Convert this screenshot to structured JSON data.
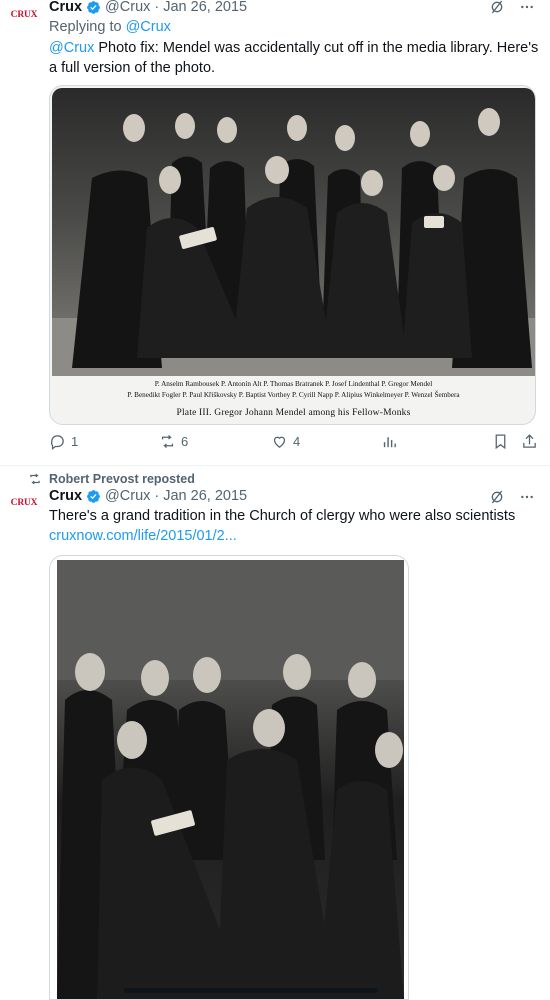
{
  "tweet1": {
    "avatar_text": "CRUX",
    "name": "Crux",
    "handle": "@Crux",
    "separator": "·",
    "date": "Jan 26, 2015",
    "replying_prefix": "Replying to",
    "replying_handle": "@Crux",
    "mention": "@Crux",
    "body": " Photo fix: Mendel was accidentally cut off in the media library. Here's a full version of the photo.",
    "caption_line1": "P. Anselm Rambousek P. Antonín Alt  P. Thomas Bratranek P. Josef Lindenthal  P. Gregor Mendel",
    "caption_line2": "P. Benedikt Fogler P. Paul Křiškovsky     P. Baptist Vorthey  P. Cyrill Napp  P. Alipius Winkelmeyer P. Wenzel Šembera",
    "caption_plate": "Plate III.  Gregor  Johann  Mendel  among  his  Fellow-Monks",
    "replies": "1",
    "reposts": "6",
    "likes": "4"
  },
  "repost_label": "Robert Prevost reposted",
  "tweet2": {
    "avatar_text": "CRUX",
    "name": "Crux",
    "handle": "@Crux",
    "separator": "·",
    "date": "Jan 26, 2015",
    "body": "There's a grand tradition in the Church of clergy who were also scientists",
    "link": "cruxnow.com/life/2015/01/2..."
  },
  "colors": {
    "accent": "#1d9bf0",
    "brand": "#c8102e",
    "muted": "#536471"
  }
}
